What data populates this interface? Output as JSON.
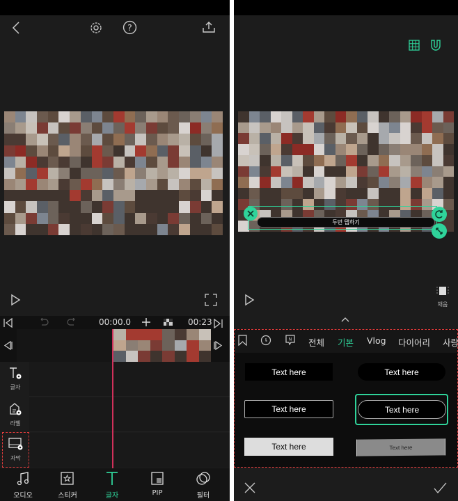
{
  "left": {
    "timeline": {
      "current_time": "00:00.0",
      "total_time": "00:23"
    },
    "side_tools": [
      {
        "label": "글자",
        "icon": "text-add-icon"
      },
      {
        "label": "라벨",
        "icon": "label-add-icon"
      },
      {
        "label": "자막",
        "icon": "subtitle-add-icon",
        "highlighted": true
      }
    ],
    "bottom_nav": [
      {
        "label": "오디오",
        "icon": "music-note-icon"
      },
      {
        "label": "스티커",
        "icon": "sticker-icon"
      },
      {
        "label": "글자",
        "icon": "text-icon",
        "active": true
      },
      {
        "label": "PIP",
        "icon": "pip-icon"
      },
      {
        "label": "필터",
        "icon": "filter-icon"
      }
    ]
  },
  "right": {
    "overlay_text": "두번 탭하기",
    "fill_label": "채움",
    "tabs": [
      "전체",
      "기본",
      "Vlog",
      "다이어리",
      "사랑"
    ],
    "active_tab": "기본",
    "templates": [
      "Text here",
      "Text here",
      "Text here",
      "Text here",
      "Text here",
      "Text here"
    ],
    "selected_template": 3
  },
  "colors": {
    "accent": "#2fd39a",
    "playhead": "#d0305a",
    "highlight": "#e03c3c"
  }
}
